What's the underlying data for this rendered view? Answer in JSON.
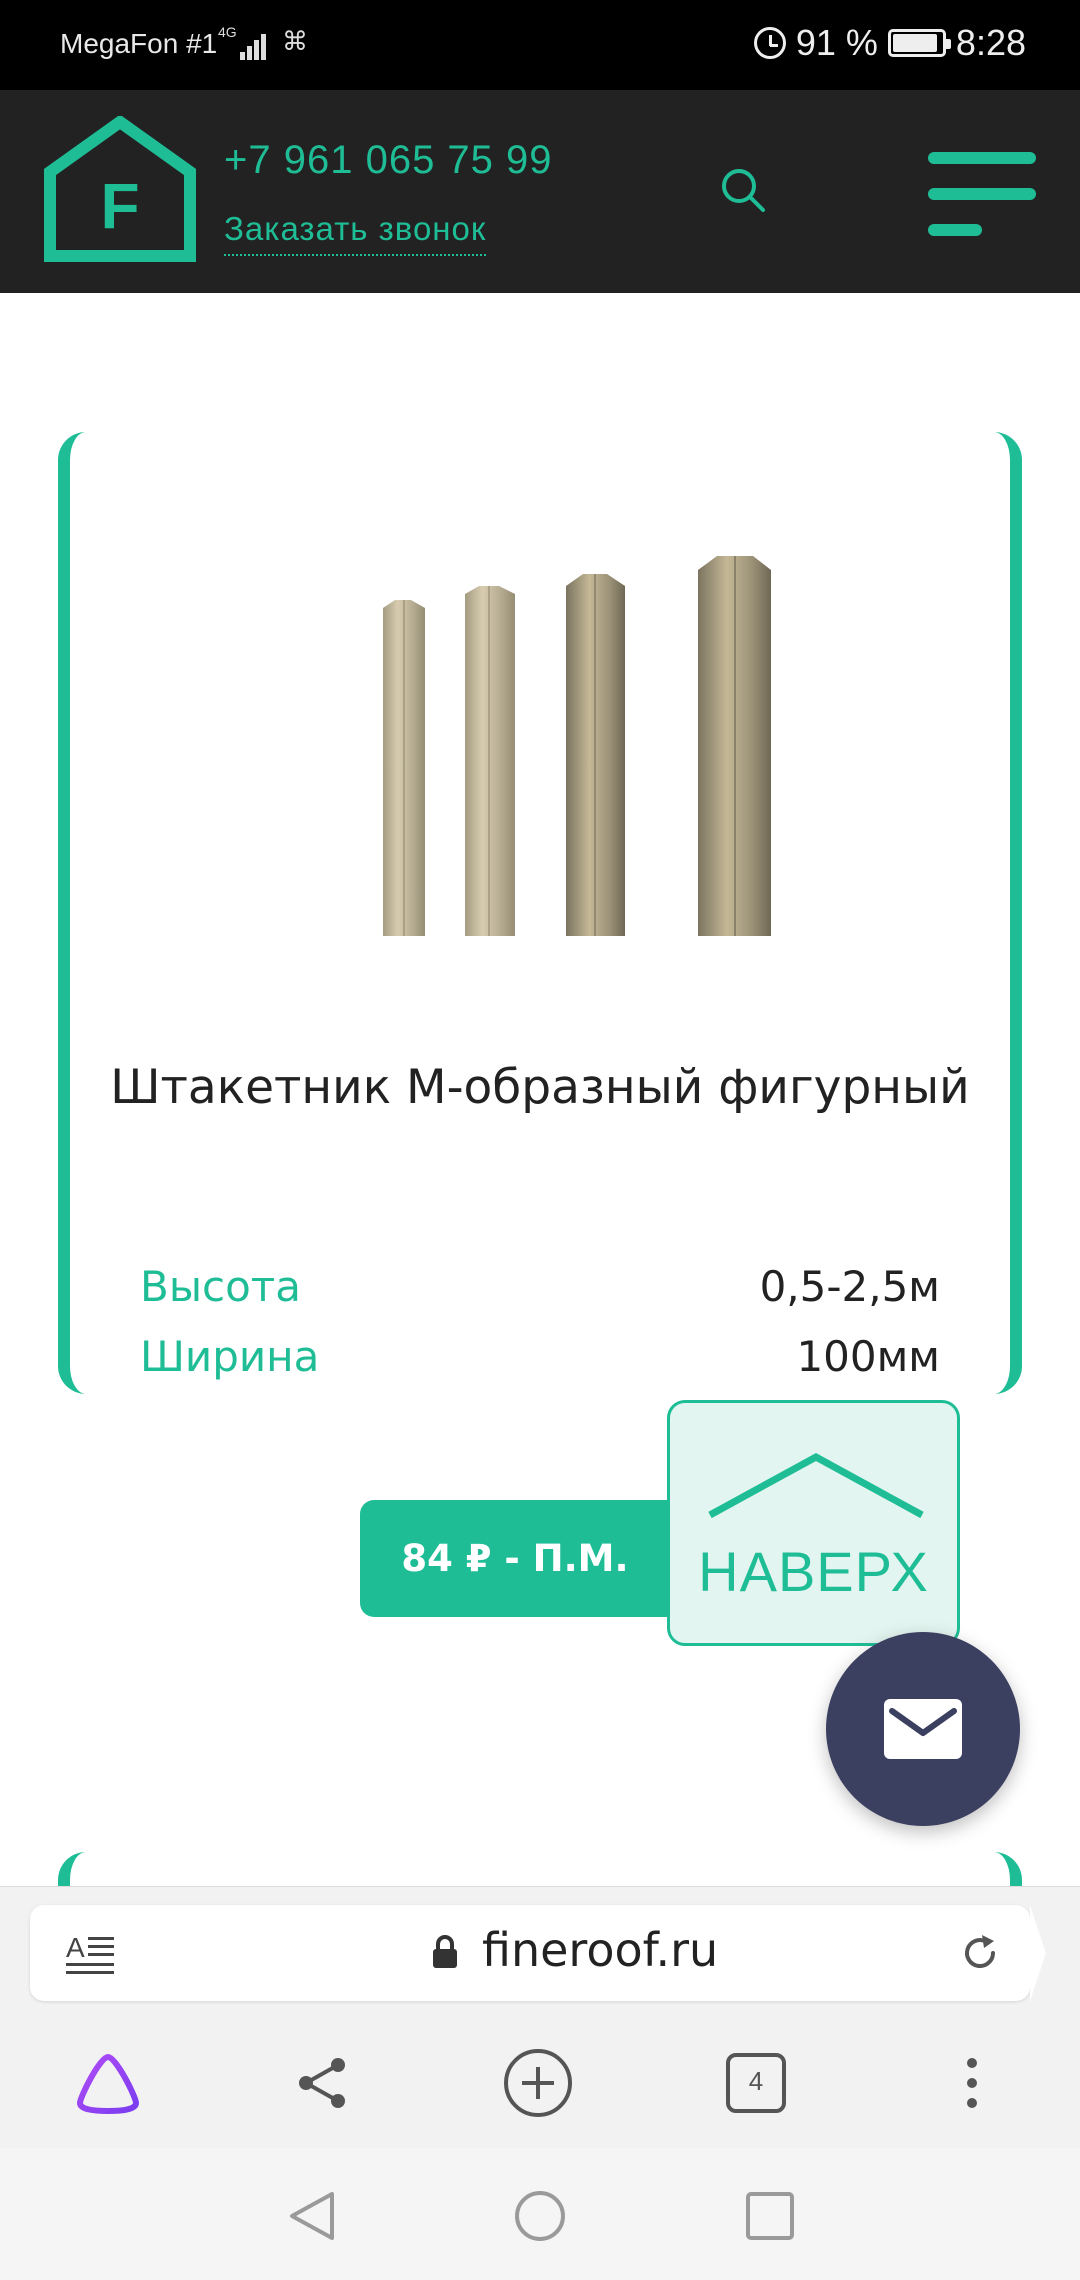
{
  "status_bar": {
    "carrier": "MegaFon #1",
    "network": "4G",
    "battery": "91 %",
    "battery_level": 0.91,
    "time": "8:28",
    "icons": [
      "signal-icon",
      "alarm-icon",
      "battery-icon"
    ]
  },
  "header": {
    "logo_letter": "F",
    "phone": "+7 961 065 75 99",
    "callback_label": "Заказать звонок",
    "accent_color": "#1fbd96",
    "background_color": "#222222"
  },
  "product": {
    "title": "Штакетник М-образный фигурный",
    "specs": [
      {
        "label": "Высота",
        "value": "0,5-2,5м"
      },
      {
        "label": "Ширина",
        "value": "100мм"
      }
    ],
    "price_label": "84 ₽ - П.М."
  },
  "to_top": {
    "label": "НАВЕРХ"
  },
  "browser": {
    "url": "fineroof.ru",
    "tab_count": "4",
    "toolbar_icons": [
      "alice-icon",
      "share-icon",
      "new-tab-icon",
      "tabs-icon",
      "more-icon"
    ]
  },
  "nav": {
    "icons": [
      "back-icon",
      "home-icon",
      "recents-icon"
    ]
  }
}
